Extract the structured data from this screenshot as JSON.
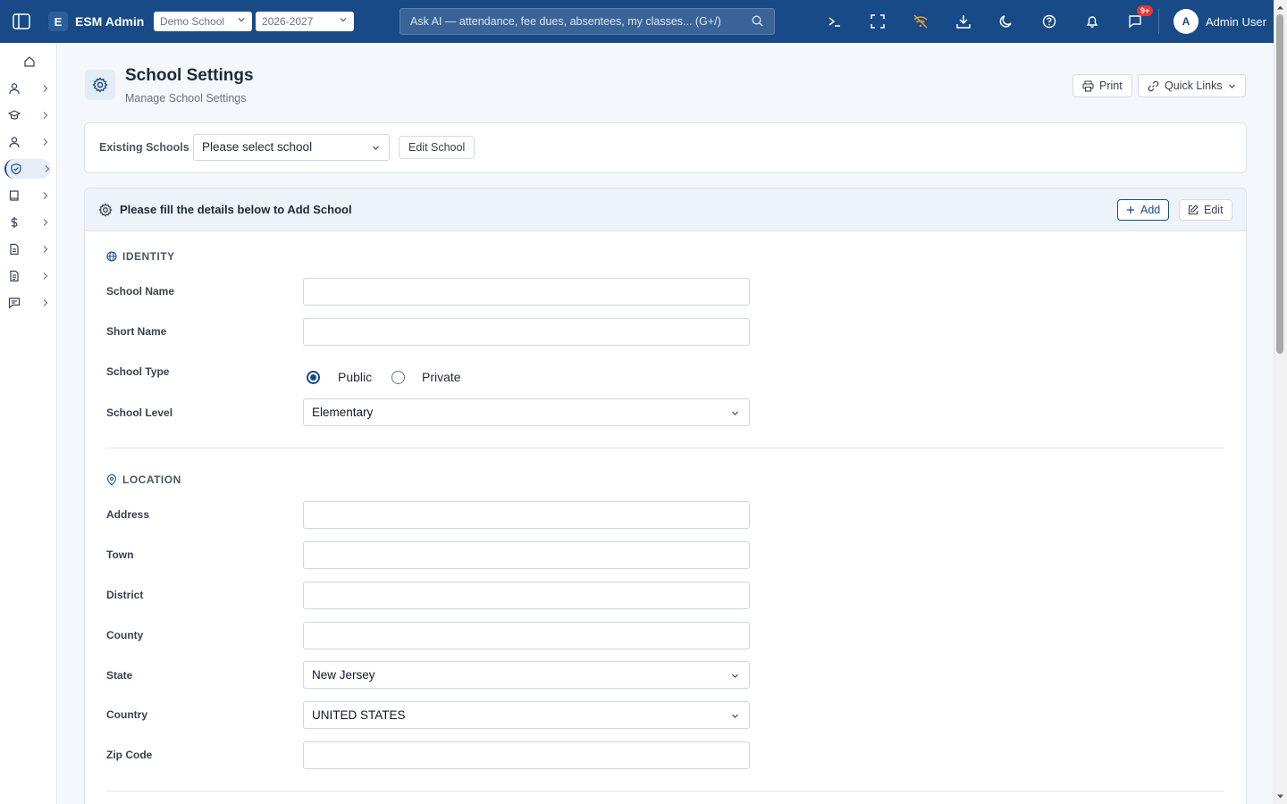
{
  "topbar": {
    "logo_letter": "E",
    "app_name": "ESM Admin",
    "school_select": "Demo School",
    "year_select": "2026-2027",
    "search_placeholder": "Ask AI — attendance, fee dues, absentees, my classes... (G+/)",
    "notification_badge": "9+",
    "avatar_letter": "A",
    "user_name": "Admin User",
    "bg_color": "#174a86"
  },
  "sidebar": {
    "items": [
      {
        "icon": "home-icon"
      },
      {
        "icon": "user-icon"
      },
      {
        "icon": "graduation-cap-icon"
      },
      {
        "icon": "user-icon"
      },
      {
        "icon": "shield-icon",
        "active": true
      },
      {
        "icon": "book-icon"
      },
      {
        "icon": "dollar-icon"
      },
      {
        "icon": "file-icon"
      },
      {
        "icon": "document-icon"
      },
      {
        "icon": "message-icon"
      }
    ]
  },
  "header": {
    "title": "School Settings",
    "subtitle": "Manage School Settings",
    "print_label": "Print",
    "quick_links_label": "Quick Links"
  },
  "existing": {
    "label": "Existing Schools",
    "select_value": "Please select school",
    "edit_label": "Edit School"
  },
  "form": {
    "header_text": "Please fill the details below to Add School",
    "add_label": "Add",
    "edit_label": "Edit",
    "identity": {
      "title": "IDENTITY",
      "school_name_label": "School Name",
      "school_name_value": "",
      "short_name_label": "Short Name",
      "short_name_value": "",
      "school_type_label": "School Type",
      "type_public": "Public",
      "type_private": "Private",
      "type_selected": "Public",
      "school_level_label": "School Level",
      "school_level_value": "Elementary"
    },
    "location": {
      "title": "LOCATION",
      "address_label": "Address",
      "address_value": "",
      "town_label": "Town",
      "town_value": "",
      "district_label": "District",
      "district_value": "",
      "county_label": "County",
      "county_value": "",
      "state_label": "State",
      "state_value": "New Jersey",
      "country_label": "Country",
      "country_value": "UNITED STATES",
      "zip_label": "Zip Code",
      "zip_value": ""
    }
  },
  "colors": {
    "accent": "#174a86",
    "page_bg": "#f4f7fb",
    "badge": "#e53935"
  }
}
